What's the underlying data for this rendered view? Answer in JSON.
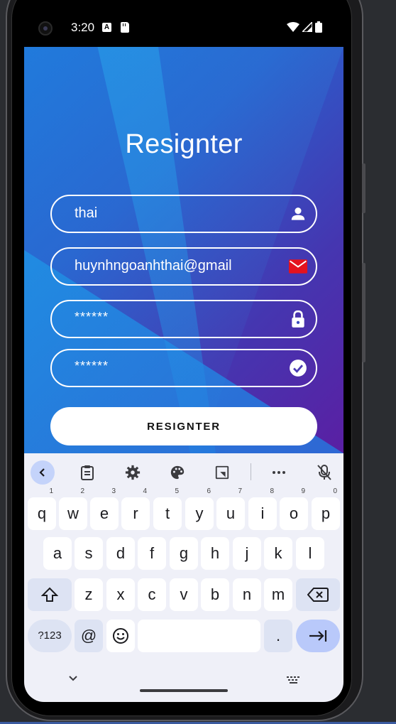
{
  "status_bar": {
    "time": "3:20",
    "notif_icons": [
      "a-notification-icon",
      "sd-card-icon"
    ],
    "system_icons": [
      "wifi-icon",
      "signal-icon",
      "battery-icon"
    ]
  },
  "app": {
    "title": "Resignter",
    "fields": [
      {
        "name": "username",
        "value": "thai",
        "icon": "person-icon"
      },
      {
        "name": "email",
        "value": "huynhngoanhthai@gmail",
        "icon": "mail-icon"
      },
      {
        "name": "password",
        "value": "******",
        "icon": "lock-icon"
      },
      {
        "name": "confirm-password",
        "value": "******",
        "icon": "check-circle-icon"
      }
    ],
    "submit_label": "RESIGNTER",
    "colors": {
      "gradient_start": "#1f6fd8",
      "gradient_end": "#5a1fa3",
      "mail_icon": "#e4121e"
    }
  },
  "keyboard": {
    "toolbar": [
      "back-icon",
      "clipboard-icon",
      "settings-icon",
      "palette-icon",
      "resize-icon",
      "more-icon",
      "mic-off-icon"
    ],
    "row1": [
      {
        "k": "q",
        "h": "1"
      },
      {
        "k": "w",
        "h": "2"
      },
      {
        "k": "e",
        "h": "3"
      },
      {
        "k": "r",
        "h": "4"
      },
      {
        "k": "t",
        "h": "5"
      },
      {
        "k": "y",
        "h": "6"
      },
      {
        "k": "u",
        "h": "7"
      },
      {
        "k": "i",
        "h": "8"
      },
      {
        "k": "o",
        "h": "9"
      },
      {
        "k": "p",
        "h": "0"
      }
    ],
    "row2": [
      "a",
      "s",
      "d",
      "f",
      "g",
      "h",
      "j",
      "k",
      "l"
    ],
    "row3": [
      "z",
      "x",
      "c",
      "v",
      "b",
      "n",
      "m"
    ],
    "sym_label": "?123",
    "at_label": "@",
    "period_label": "."
  }
}
